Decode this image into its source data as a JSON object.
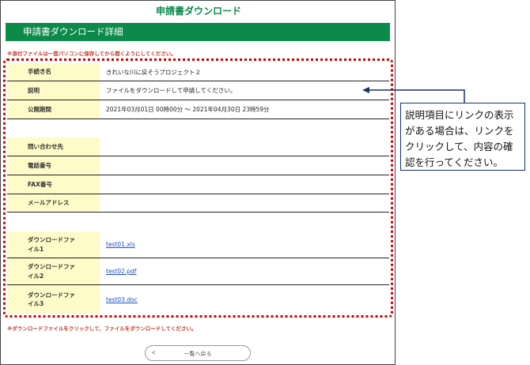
{
  "header": {
    "title": "申請書ダウンロード",
    "section_title": "申請書ダウンロード詳細"
  },
  "notes": {
    "top": "※添付ファイルは一度パソコンに保存してから開くようにしてください。",
    "bottom": "※ダウンロードファイルをクリックして、ファイルをダウンロードしてください。"
  },
  "details": {
    "procedure_name": {
      "label": "手続き名",
      "value": "きれいな川に戻そうプロジェクト２"
    },
    "description": {
      "label": "説明",
      "value": "ファイルをダウンロードして申請してください。"
    },
    "period": {
      "label": "公開期間",
      "value": "2021年03月01日 00時00分 ～ 2021年04月30日 23時59分"
    },
    "contact": {
      "label": "問い合わせ先",
      "value": ""
    },
    "phone": {
      "label": "電話番号",
      "value": ""
    },
    "fax": {
      "label": "FAX番号",
      "value": ""
    },
    "email": {
      "label": "メールアドレス",
      "value": ""
    }
  },
  "downloads": [
    {
      "label_line1": "ダウンロードファ",
      "label_line2": "イル1",
      "file": "test01.xls"
    },
    {
      "label_line1": "ダウンロードファ",
      "label_line2": "イル2",
      "file": "test02.pdf"
    },
    {
      "label_line1": "ダウンロードファ",
      "label_line2": "イル3",
      "file": "test03.doc"
    }
  ],
  "back_button": {
    "chevron": "<",
    "label": "一覧へ戻る"
  },
  "callout": {
    "line1": "説明項目にリンクの表示",
    "line2": "がある場合は、リンクを",
    "line3": "クリックして、内容の確",
    "line4": "認を行ってください。"
  },
  "colors": {
    "brand": "#0b8a4a",
    "label_bg": "#fffbc8",
    "note": "#c0392b",
    "highlight": "#d00000",
    "callout_border": "#1a2f6e"
  },
  "icons": {
    "back": "chevron-left-icon",
    "pointer": "arrow-left-icon"
  }
}
